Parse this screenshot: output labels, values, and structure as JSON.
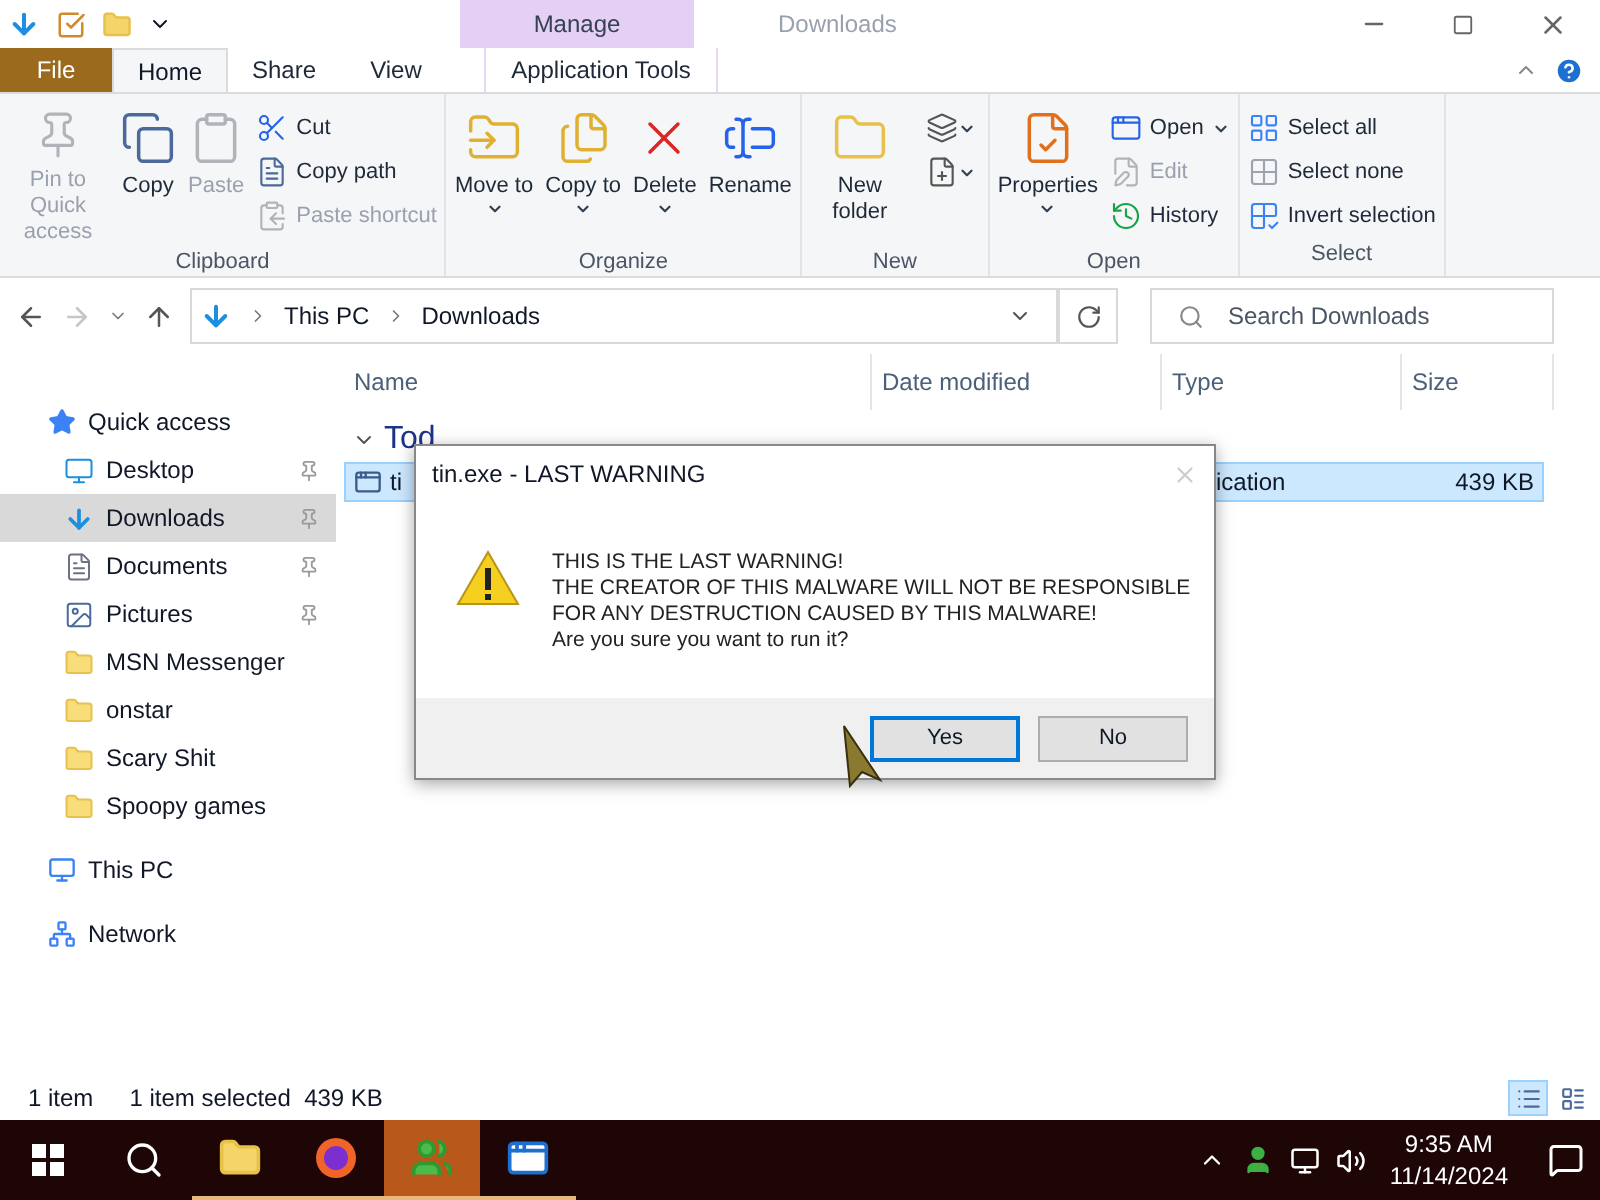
{
  "window": {
    "title": "Downloads",
    "context_header": "Manage"
  },
  "ribbon_tabs": [
    {
      "label": "File",
      "kind": "file",
      "selected": false
    },
    {
      "label": "Home",
      "kind": "tab",
      "selected": true
    },
    {
      "label": "Share",
      "kind": "tab",
      "selected": false
    },
    {
      "label": "View",
      "kind": "tab",
      "selected": false
    },
    {
      "label": "Application Tools",
      "kind": "context",
      "selected": false
    }
  ],
  "ribbon_groups": [
    {
      "label": "Clipboard",
      "commands": [
        {
          "label": "Pin to Quick access",
          "kind": "large",
          "disabled": true,
          "menu": false
        },
        {
          "label": "Copy",
          "kind": "large",
          "disabled": false,
          "menu": false
        },
        {
          "label": "Paste",
          "kind": "large",
          "disabled": true,
          "menu": false
        },
        {
          "label": "Cut",
          "kind": "small",
          "disabled": false,
          "menu": false
        },
        {
          "label": "Copy path",
          "kind": "small",
          "disabled": false,
          "menu": false
        },
        {
          "label": "Paste shortcut",
          "kind": "small",
          "disabled": true,
          "menu": false
        }
      ]
    },
    {
      "label": "Organize",
      "commands": [
        {
          "label": "Move to",
          "kind": "large",
          "disabled": false,
          "menu": true
        },
        {
          "label": "Copy to",
          "kind": "large",
          "disabled": false,
          "menu": true
        },
        {
          "label": "Delete",
          "kind": "large",
          "disabled": false,
          "menu": true
        },
        {
          "label": "Rename",
          "kind": "large",
          "disabled": false,
          "menu": false
        }
      ]
    },
    {
      "label": "New",
      "commands": [
        {
          "label": "New folder",
          "kind": "large",
          "disabled": false,
          "menu": false
        },
        {
          "kind": "icon",
          "disabled": false,
          "menu": true
        },
        {
          "kind": "icon",
          "disabled": false,
          "menu": true
        }
      ]
    },
    {
      "label": "Open",
      "commands": [
        {
          "label": "Properties",
          "kind": "large",
          "disabled": false,
          "menu": true
        },
        {
          "label": "Open",
          "kind": "small",
          "disabled": false,
          "menu": true
        },
        {
          "label": "Edit",
          "kind": "small",
          "disabled": true,
          "menu": false
        },
        {
          "label": "History",
          "kind": "small",
          "disabled": false,
          "menu": false
        }
      ]
    },
    {
      "label": "Select",
      "commands": [
        {
          "label": "Select all",
          "kind": "small",
          "disabled": false,
          "menu": false
        },
        {
          "label": "Select none",
          "kind": "small",
          "disabled": false,
          "menu": false
        },
        {
          "label": "Invert selection",
          "kind": "small",
          "disabled": false,
          "menu": false
        }
      ]
    }
  ],
  "address_bar": {
    "path": [
      "This PC",
      "Downloads"
    ],
    "forward_disabled": true
  },
  "search": {
    "placeholder": "Search Downloads"
  },
  "sidebar": {
    "items": [
      {
        "label": "Quick access",
        "selected": false,
        "children": [
          {
            "label": "Desktop",
            "selected": false,
            "pinned": true
          },
          {
            "label": "Downloads",
            "selected": true,
            "pinned": true
          },
          {
            "label": "Documents",
            "selected": false,
            "pinned": true
          },
          {
            "label": "Pictures",
            "selected": false,
            "pinned": true
          },
          {
            "label": "MSN Messenger",
            "selected": false,
            "pinned": false
          },
          {
            "label": "onstar",
            "selected": false,
            "pinned": false
          },
          {
            "label": "Scary Shit",
            "selected": false,
            "pinned": false
          },
          {
            "label": "Spoopy games",
            "selected": false,
            "pinned": false
          }
        ]
      },
      {
        "label": "This PC",
        "selected": false
      },
      {
        "label": "Network",
        "selected": false
      }
    ]
  },
  "file_list": {
    "columns": [
      "Name",
      "Date modified",
      "Type",
      "Size"
    ],
    "groups": [
      {
        "label": "Tod",
        "expanded": true,
        "rows": [
          {
            "name": "ti",
            "type": "ication",
            "size": "439 KB",
            "selected": true
          }
        ]
      }
    ]
  },
  "dialog": {
    "title": "tin.exe - LAST WARNING",
    "message": [
      "THIS IS THE LAST WARNING!",
      "THE CREATOR OF THIS MALWARE WILL NOT BE RESPONSIBLE",
      "FOR ANY DESTRUCTION CAUSED BY THIS MALWARE!",
      "Are you sure you want to run it?"
    ],
    "buttons": [
      {
        "label": "Yes",
        "selected": true
      },
      {
        "label": "No",
        "selected": false
      }
    ]
  },
  "status_bar": {
    "count": "1 item",
    "selection": "1 item selected  439 KB",
    "views": [
      {
        "selected": true
      },
      {
        "selected": false
      }
    ]
  },
  "taskbar": {
    "apps": [
      {
        "active": false,
        "running": true
      },
      {
        "active": false,
        "running": true
      },
      {
        "active": true,
        "running": true
      },
      {
        "active": false,
        "running": true
      }
    ],
    "time": "9:35 AM",
    "date": "11/14/2024"
  }
}
